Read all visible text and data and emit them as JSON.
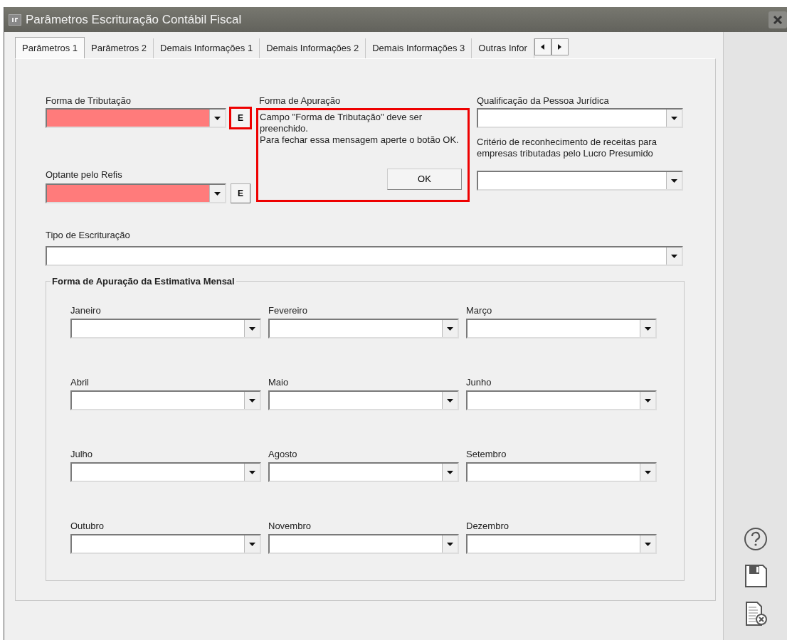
{
  "window": {
    "title": "Parâmetros Escrituração Contábil Fiscal"
  },
  "tabs": [
    {
      "label": "Parâmetros 1",
      "selected": true
    },
    {
      "label": "Parâmetros 2",
      "selected": false
    },
    {
      "label": "Demais Informações 1",
      "selected": false
    },
    {
      "label": "Demais Informações 2",
      "selected": false
    },
    {
      "label": "Demais Informações 3",
      "selected": false
    },
    {
      "label": "Outras Infor",
      "selected": false
    }
  ],
  "forma_tributacao": {
    "label": "Forma de Tributação",
    "invalid": true,
    "button": {
      "label": "E",
      "highlighted": true
    }
  },
  "optante_refis": {
    "label": "Optante pelo Refis",
    "invalid": true,
    "button": {
      "label": "E",
      "highlighted": false
    }
  },
  "forma_apuracao": {
    "label": "Forma de Apuração"
  },
  "qualificacao": {
    "label": "Qualificação da Pessoa Jurídica",
    "invalid": false
  },
  "criterio": {
    "label": "Critério de reconhecimento de receitas para empresas tributadas pelo Lucro Presumido",
    "invalid": false
  },
  "tipo_escrituracao": {
    "label": "Tipo de Escrituração",
    "invalid": false
  },
  "message": {
    "lines": [
      "Campo \"Forma de Tributação\" deve ser preenchido.",
      "Para fechar essa mensagem aperte o botão OK."
    ],
    "button": "OK"
  },
  "estimativa": {
    "title": "Forma de Apuração da Estimativa Mensal",
    "months": [
      {
        "label": "Janeiro",
        "invalid": false
      },
      {
        "label": "Fevereiro",
        "invalid": false
      },
      {
        "label": "Março",
        "invalid": false
      },
      {
        "label": "Abril",
        "invalid": false
      },
      {
        "label": "Maio",
        "invalid": false
      },
      {
        "label": "Junho",
        "invalid": false
      },
      {
        "label": "Julho",
        "invalid": false
      },
      {
        "label": "Agosto",
        "invalid": false
      },
      {
        "label": "Setembro",
        "invalid": false
      },
      {
        "label": "Outubro",
        "invalid": false
      },
      {
        "label": "Novembro",
        "invalid": false
      },
      {
        "label": "Dezembro",
        "invalid": false
      }
    ]
  }
}
